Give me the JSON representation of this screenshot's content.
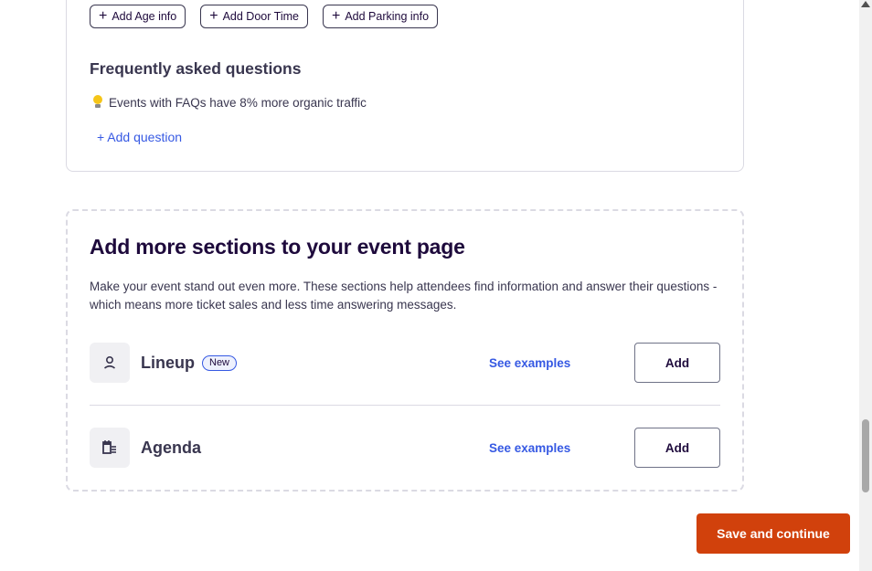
{
  "faq_card": {
    "chips": [
      {
        "label": "Add Age info"
      },
      {
        "label": "Add Door Time"
      },
      {
        "label": "Add Parking info"
      }
    ],
    "title": "Frequently asked questions",
    "tip_text": "Events with FAQs have 8% more organic traffic",
    "add_question_label": "+ Add question"
  },
  "more_sections": {
    "title": "Add more sections to your event page",
    "description": "Make your event stand out even more. These sections help attendees find information and answer their questions - which means more ticket sales and less time answering messages.",
    "rows": [
      {
        "label": "Lineup",
        "badge": "New",
        "examples_label": "See examples",
        "add_label": "Add",
        "icon": "person-icon"
      },
      {
        "label": "Agenda",
        "badge": "",
        "examples_label": "See examples",
        "add_label": "Add",
        "icon": "calendar-list-icon"
      }
    ]
  },
  "footer": {
    "save_label": "Save and continue"
  },
  "colors": {
    "accent_link": "#3659e3",
    "primary_button": "#d1410c",
    "heading": "#1e0a3c"
  }
}
